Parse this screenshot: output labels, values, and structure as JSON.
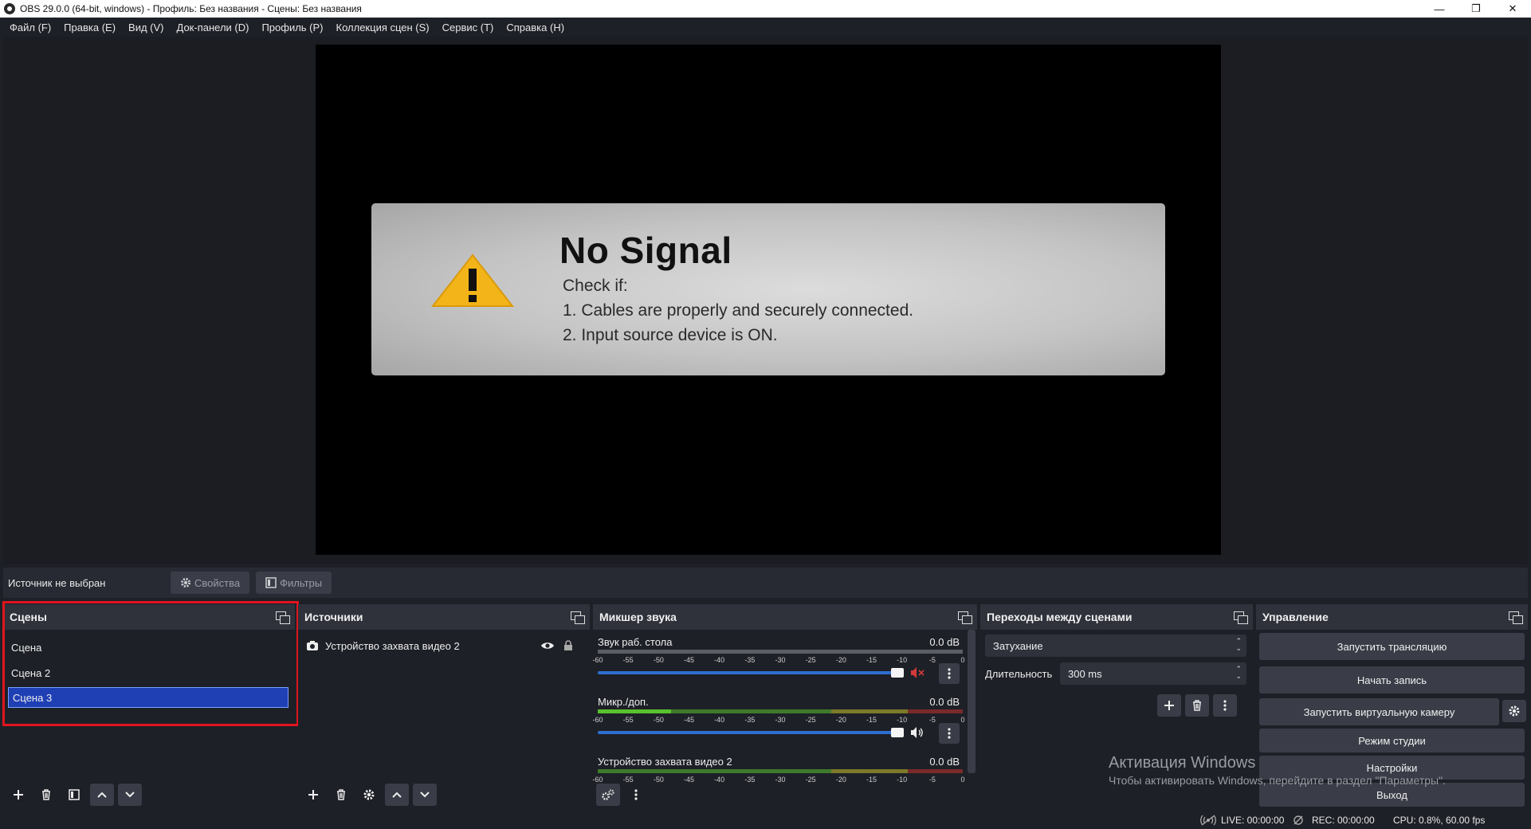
{
  "window": {
    "title": "OBS 29.0.0 (64-bit, windows) - Профиль: Без названия - Сцены: Без названия",
    "minimize": "—",
    "restore": "❐",
    "close": "✕"
  },
  "menu": [
    "Файл (F)",
    "Правка (E)",
    "Вид (V)",
    "Док-панели (D)",
    "Профиль (P)",
    "Коллекция сцен (S)",
    "Сервис (T)",
    "Справка (H)"
  ],
  "preview": {
    "title": "No Signal",
    "line1": "Check if:",
    "line2": "1. Cables are properly and securely connected.",
    "line3": "2. Input source device is ON."
  },
  "source_toolbar": {
    "no_source": "Источник не выбран",
    "properties": "Свойства",
    "filters": "Фильтры"
  },
  "scenes": {
    "title": "Сцены",
    "items": [
      "Сцена",
      "Сцена 2",
      "Сцена 3"
    ],
    "selected": "Сцена 3"
  },
  "sources": {
    "title": "Источники",
    "items": [
      "Устройство захвата видео 2"
    ]
  },
  "mixer": {
    "title": "Микшер звука",
    "ticks": [
      "-60",
      "-55",
      "-50",
      "-45",
      "-40",
      "-35",
      "-30",
      "-25",
      "-20",
      "-15",
      "-10",
      "-5",
      "0"
    ],
    "channels": [
      {
        "name": "Звук раб. стола",
        "db": "0.0 dB",
        "muted": true,
        "level": 0
      },
      {
        "name": "Микр./доп.",
        "db": "0.0 dB",
        "muted": false,
        "level": 0.2
      },
      {
        "name": "Устройство захвата видео 2",
        "db": "0.0 dB",
        "muted": false,
        "level": 0
      }
    ]
  },
  "transitions": {
    "title": "Переходы между сценами",
    "selected": "Затухание",
    "duration_label": "Длительность",
    "duration_value": "300 ms"
  },
  "controls": {
    "title": "Управление",
    "start_stream": "Запустить трансляцию",
    "start_record": "Начать запись",
    "start_vcam": "Запустить виртуальную камеру",
    "studio_mode": "Режим студии",
    "settings": "Настройки",
    "exit": "Выход"
  },
  "watermark": {
    "line1": "Активация Windows",
    "line2": "Чтобы активировать Windows, перейдите в раздел \"Параметры\"."
  },
  "status": {
    "live": "LIVE: 00:00:00",
    "rec": "REC: 00:00:00",
    "cpu": "CPU: 0.8%, 60.00 fps"
  },
  "colors": {
    "accent_selection": "#1f3fb5",
    "highlight_box": "#e0141e",
    "volume_fader": "#2d6ed0",
    "muted_icon": "#d23a3a"
  }
}
